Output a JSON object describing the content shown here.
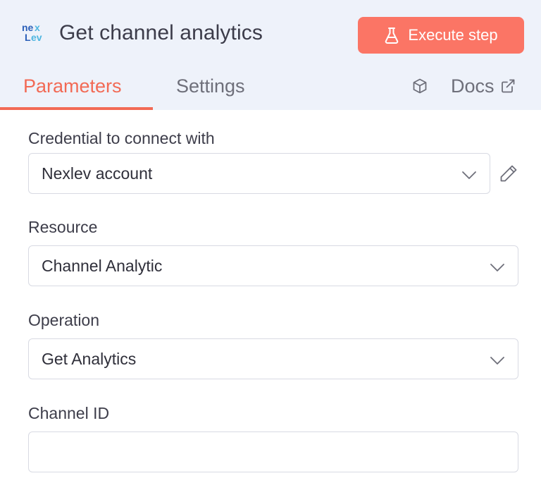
{
  "header": {
    "logo_icon": "nexlev-logo-icon",
    "title": "Get channel analytics",
    "execute_button": {
      "label": "Execute step",
      "icon": "flask-icon",
      "color": "#fb7565"
    }
  },
  "tabs": [
    {
      "label": "Parameters",
      "active": true,
      "color": "#f26a55"
    },
    {
      "label": "Settings",
      "active": false
    }
  ],
  "docs": {
    "label": "Docs",
    "icon": "external-link-icon",
    "node_icon": "cube-icon"
  },
  "form": {
    "credential": {
      "label": "Credential to connect with",
      "value": "Nexlev account",
      "edit_icon": "pencil-icon"
    },
    "resource": {
      "label": "Resource",
      "value": "Channel Analytic"
    },
    "operation": {
      "label": "Operation",
      "value": "Get Analytics"
    },
    "channel_id": {
      "label": "Channel ID",
      "value": ""
    }
  }
}
